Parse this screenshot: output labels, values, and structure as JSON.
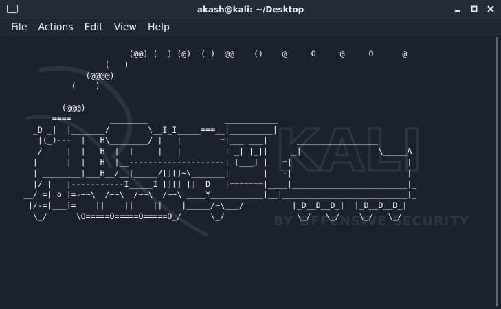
{
  "window": {
    "title": "akash@kali: ~/Desktop",
    "icon": "terminal-window-icon",
    "controls": [
      "minimize-icon",
      "maximize-icon",
      "close-icon"
    ]
  },
  "menu": {
    "file": "File",
    "actions": "Actions",
    "edit": "Edit",
    "view": "View",
    "help": "Help"
  },
  "terminal": {
    "watermark_text": "KALI",
    "watermark_subtitle": "BY OFFENSIVE SECURITY",
    "ascii_lines": [
      "                          (@@) (  ) (@)  ( )  @@    ()    @     O     @     O      @",
      "                     (   )",
      "                 (@@@@)",
      "              (    )",
      "",
      "            (@@@)",
      "          ====        ________                ___________",
      "      _D _|  |_______/        \\__I_I_____===__|_________|",
      "       |(_)---  |   H\\________/ |   |        =|___ ___|      _________________",
      "       /     |  |   H  |  |     |   |         ||_| |_||     _|                \\_____A",
      "      |      |  |   H  |__--------------------| [___] |   =|                        |",
      "      | ________|___H__/__|_____/[][]~\\_______|       |   -|                        |",
      "      |/ |   |-----------I_____I [][] []  D   |=======|____|________________________|_",
      "    __/ =| o |=-~~\\  /~~\\  /~~\\  /~~\\ ____Y___________|__|__________________________|_",
      "     |/-=|___|=    ||    ||    ||    |_____/~\\___/          |_D__D__D_|  |_D__D__D_|",
      "      \\_/      \\O=====O=====O=====O_/      \\_/               \\_/   \\_/    \\_/   \\_/"
    ]
  },
  "colors": {
    "terminal_bg": "#1b222d",
    "titlebar_bg": "#232c38",
    "text": "#f2f4f7"
  }
}
